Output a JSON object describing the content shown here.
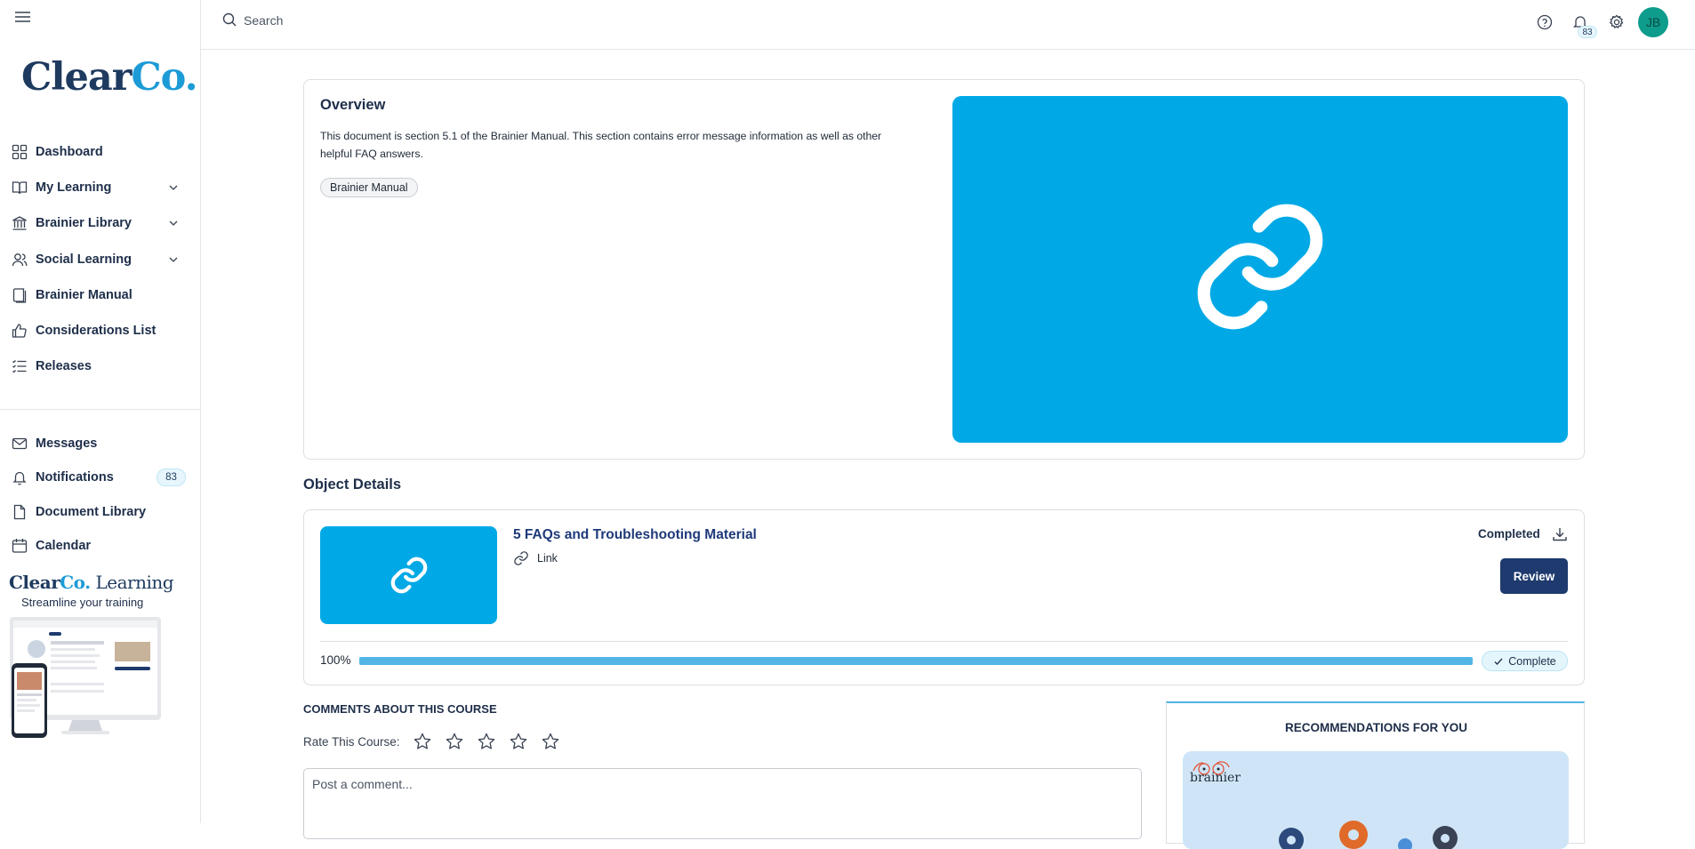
{
  "sidebar": {
    "brand_first": "Clear",
    "brand_second": "Co.",
    "nav": [
      {
        "label": "Dashboard",
        "icon": "dashboard-icon"
      },
      {
        "label": "My Learning",
        "icon": "book-icon",
        "expandable": true
      },
      {
        "label": "Brainier Library",
        "icon": "library-icon",
        "expandable": true
      },
      {
        "label": "Social Learning",
        "icon": "users-icon",
        "expandable": true
      },
      {
        "label": "Brainier Manual",
        "icon": "manual-icon"
      },
      {
        "label": "Considerations List",
        "icon": "thumbs-up-icon"
      },
      {
        "label": "Releases",
        "icon": "list-icon"
      }
    ],
    "secondary": [
      {
        "label": "Messages",
        "icon": "mail-icon"
      },
      {
        "label": "Notifications",
        "icon": "bell-icon",
        "badge": "83"
      },
      {
        "label": "Document Library",
        "icon": "document-icon"
      },
      {
        "label": "Calendar",
        "icon": "calendar-icon"
      }
    ],
    "promo": {
      "brand_first": "Clear",
      "brand_second": "Co.",
      "brand_third": " Learning",
      "tagline": "Streamline your training"
    }
  },
  "topbar": {
    "search_placeholder": "Search",
    "notification_count": "83",
    "avatar_initials": "JB"
  },
  "overview": {
    "title": "Overview",
    "description": "This document is section 5.1 of the Brainier Manual. This section contains error message information as well as other helpful FAQ answers.",
    "tag": "Brainier Manual"
  },
  "object_details": {
    "section_title": "Object Details",
    "title": "5 FAQs and Troubleshooting Material",
    "type": "Link",
    "status": "Completed",
    "review_label": "Review",
    "progress_label": "100%",
    "progress_value": 1.0,
    "complete_label": "Complete"
  },
  "comments": {
    "title": "COMMENTS ABOUT THIS COURSE",
    "rate_label": "Rate This Course:",
    "rating": 0,
    "placeholder": "Post a comment..."
  },
  "recommendations": {
    "title": "RECOMMENDATIONS FOR YOU",
    "brand": "brainier"
  },
  "colors": {
    "accent": "#00a9e6",
    "navy": "#1e3a6e",
    "progress": "#52b5e6",
    "avatar": "#0e9c8c"
  }
}
